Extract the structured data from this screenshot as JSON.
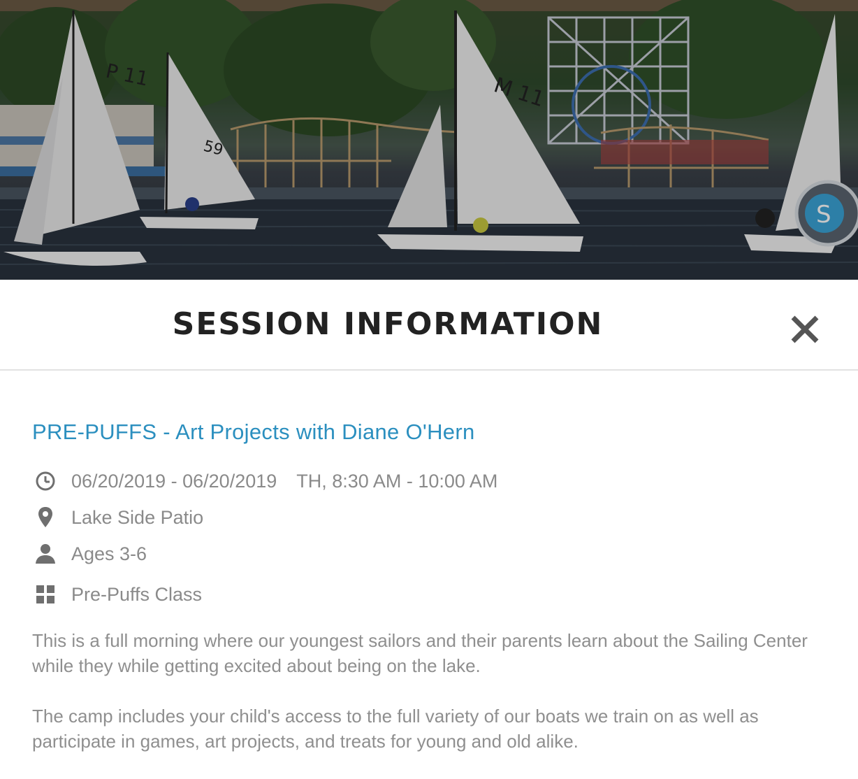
{
  "header": {
    "title": "SESSION INFORMATION",
    "close_icon": "close-icon"
  },
  "hero": {
    "sail_numbers": [
      "P 11",
      "59",
      "M 11"
    ]
  },
  "session": {
    "title": "PRE-PUFFS - Art Projects with Diane O'Hern",
    "title_color": "#2b8fbf",
    "dates": "06/20/2019 - 06/20/2019",
    "schedule": "TH, 8:30 AM - 10:00 AM",
    "location": "Lake Side Patio",
    "ages": "Ages 3-6",
    "class": "Pre-Puffs Class",
    "icons": [
      "clock-icon",
      "location-pin-icon",
      "person-icon",
      "grid-icon"
    ]
  },
  "description": {
    "paragraph_1": "This is a full morning where our youngest sailors and their parents learn about the Sailing Center while they while getting excited about being on the lake.",
    "paragraph_2": "The camp includes your child's access to the full variety of our boats we train on as well as participate in games, art projects, and treats for young and old alike."
  }
}
